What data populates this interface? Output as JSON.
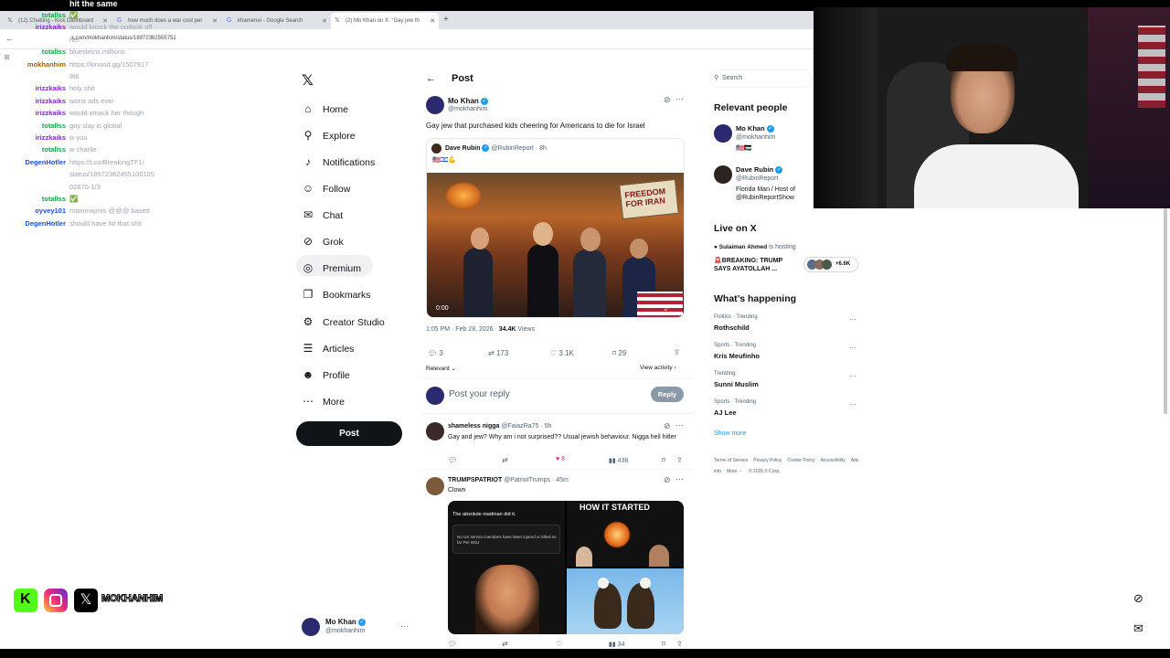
{
  "topbar": {
    "text": "hit the same"
  },
  "tabs": [
    {
      "label": "(12) Chatting - Kick Dashboard",
      "icon": "x-logo-icon"
    },
    {
      "label": "how much does a war cost per",
      "icon": "google-icon"
    },
    {
      "label": "khamenei - Google Search",
      "icon": "google-icon"
    },
    {
      "label": "(2) Mo Khan on X: \"Gay jew th",
      "icon": "x-logo-icon"
    }
  ],
  "url": "x.com/mokhanhim/status/18972362555751",
  "chat": [
    {
      "user": "totallss",
      "text": "✅",
      "color": "g"
    },
    {
      "user": "irizzkaiks",
      "text": "would knock the outlook off",
      "color": "p"
    },
    {
      "user": "",
      "text": "her",
      "color": "p"
    },
    {
      "user": "totallss",
      "text": "bluesteins millions",
      "color": "g"
    },
    {
      "user": "mokhanhim",
      "text": "https://kinood.gg/1507917",
      "color": "o"
    },
    {
      "user": "",
      "text": "8t6",
      "color": "o"
    },
    {
      "user": "irizzkaiks",
      "text": "holy shit",
      "color": "p"
    },
    {
      "user": "irizzkaiks",
      "text": "worst ads ever",
      "color": "p"
    },
    {
      "user": "irizzkaiks",
      "text": "would smack her though",
      "color": "p"
    },
    {
      "user": "totallss",
      "text": "goy slay is global",
      "color": "g"
    },
    {
      "user": "irizzkaiks",
      "text": "w you",
      "color": "p"
    },
    {
      "user": "totallss",
      "text": "w charlie",
      "color": "g"
    },
    {
      "user": "DegenHotler",
      "text": "https://t.co/BreakingTF1/",
      "color": "b"
    },
    {
      "user": "",
      "text": "status/18972362455100105",
      "color": "b"
    },
    {
      "user": "",
      "text": "02670-1/3",
      "color": "b"
    },
    {
      "user": "totallss",
      "text": "✅",
      "color": "g"
    },
    {
      "user": "oyvey101",
      "text": "mammajmis @@@ based",
      "color": "b"
    },
    {
      "user": "DegenHotler",
      "text": "should have hit that shit",
      "color": "b"
    }
  ],
  "nav": [
    {
      "label": "Home",
      "icon": "home-icon",
      "glyph": "⌂"
    },
    {
      "label": "Explore",
      "icon": "search-icon",
      "glyph": "⚲"
    },
    {
      "label": "Notifications",
      "icon": "bell-icon",
      "glyph": "♪"
    },
    {
      "label": "Follow",
      "icon": "person-add-icon",
      "glyph": "☺"
    },
    {
      "label": "Chat",
      "icon": "mail-icon",
      "glyph": "✉"
    },
    {
      "label": "Grok",
      "icon": "grok-icon",
      "glyph": "⊘"
    },
    {
      "label": "Premium",
      "icon": "premium-icon",
      "glyph": "◎"
    },
    {
      "label": "Bookmarks",
      "icon": "bookmark-icon",
      "glyph": "❐"
    },
    {
      "label": "Creator Studio",
      "icon": "studio-icon",
      "glyph": "⚙"
    },
    {
      "label": "Articles",
      "icon": "articles-icon",
      "glyph": "☰"
    },
    {
      "label": "Profile",
      "icon": "profile-icon",
      "glyph": "☻"
    },
    {
      "label": "More",
      "icon": "more-icon",
      "glyph": "⋯"
    }
  ],
  "post_button": "Post",
  "account": {
    "name": "Mo Khan",
    "handle": "@mokhanhim"
  },
  "header": {
    "title": "Post"
  },
  "tweet": {
    "name": "Mo Khan",
    "handle": "@mokhanhim",
    "text": "Gay jew that purchased kids cheering for Americans to die for Israel",
    "quote": {
      "name": "Dave Rubin",
      "handle": "@RubinReport",
      "time": "8h",
      "emojis": "🇺🇸🇮🇱💪",
      "video_time": "0:00",
      "banner": "FREEDOM FOR IRAN"
    },
    "meta": "1:05 PM · Feb 28, 2026 ·",
    "views": "34.4K",
    "views_label": "Views",
    "stats": {
      "replies": "3",
      "reposts": "173",
      "likes": "3.1K",
      "bookmarks": "29"
    },
    "sort": "Relevant",
    "view_activity": "View activity",
    "reply_placeholder": "Post your reply",
    "reply_button": "Reply"
  },
  "replies": [
    {
      "name": "shameless nigga",
      "handle": "@FaiazRa75",
      "time": "5h",
      "text": "Gay and jew? Why am i not surprised?? Usual jewish behaviour. Nigga heil hitler",
      "likes": "8",
      "views": "436"
    },
    {
      "name": "TRUMPSPATRIOT",
      "handle": "@PatriotTrumps",
      "time": "45m",
      "text": "Clown",
      "img_left_title": "The absolute madman did it.",
      "img_left_text": "No US service members have been injured or killed so far Per WSJ",
      "img_right_title": "HOW IT STARTED",
      "likes": "",
      "views": "34"
    }
  ],
  "search": {
    "placeholder": "Search"
  },
  "relevant": {
    "title": "Relevant people",
    "people": [
      {
        "name": "Mo Khan",
        "handle": "@mokhanhim",
        "bio": "🇺🇸🇵🇸"
      },
      {
        "name": "Dave Rubin",
        "handle": "@RubinReport",
        "bio": "Florida Man / Host of @RubinReportShow"
      }
    ]
  },
  "live": {
    "title": "Live on X",
    "host": "Sulaiman Ahmed",
    "hosting": "is hosting",
    "text": "🚨BREAKING: TRUMP SAYS AYATOLLAH ...",
    "count": "+6.6K"
  },
  "happening": {
    "title": "What’s happening",
    "trends": [
      {
        "cat": "Politics · Trending",
        "name": "Rothschild"
      },
      {
        "cat": "Sports · Trending",
        "name": "Kris Meufinho"
      },
      {
        "cat": "Trending",
        "name": "Sunni Muslim"
      },
      {
        "cat": "Sports · Trending",
        "name": "AJ Lee"
      }
    ],
    "show_more": "Show more"
  },
  "footer": [
    "Terms of Service",
    "Privacy Policy",
    "Cookie Policy",
    "Accessibility",
    "Ads info",
    "More ···",
    "© 2026 X Corp."
  ],
  "socials": {
    "handle": "MOKHANHIM"
  }
}
